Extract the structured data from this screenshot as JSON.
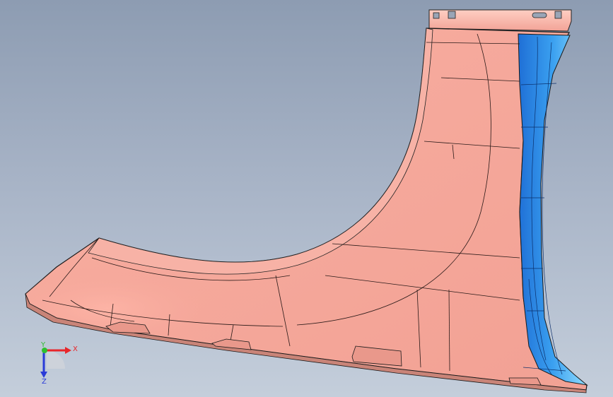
{
  "viewport": {
    "background_top": "#8d9cb2",
    "background_bottom": "#c4cedb"
  },
  "part": {
    "fender_color": "#f3a89c",
    "fender_highlight": "#ffd2c8",
    "flange_color": "#2f8de4",
    "flange_highlight": "#6fcaff",
    "edge_color": "#1a1a1a"
  },
  "triad": {
    "x_label": "X",
    "y_label": "Y",
    "z_label": "Z",
    "x_color": "#e8262a",
    "y_color": "#2fbf2f",
    "z_color": "#2a3bd8"
  }
}
